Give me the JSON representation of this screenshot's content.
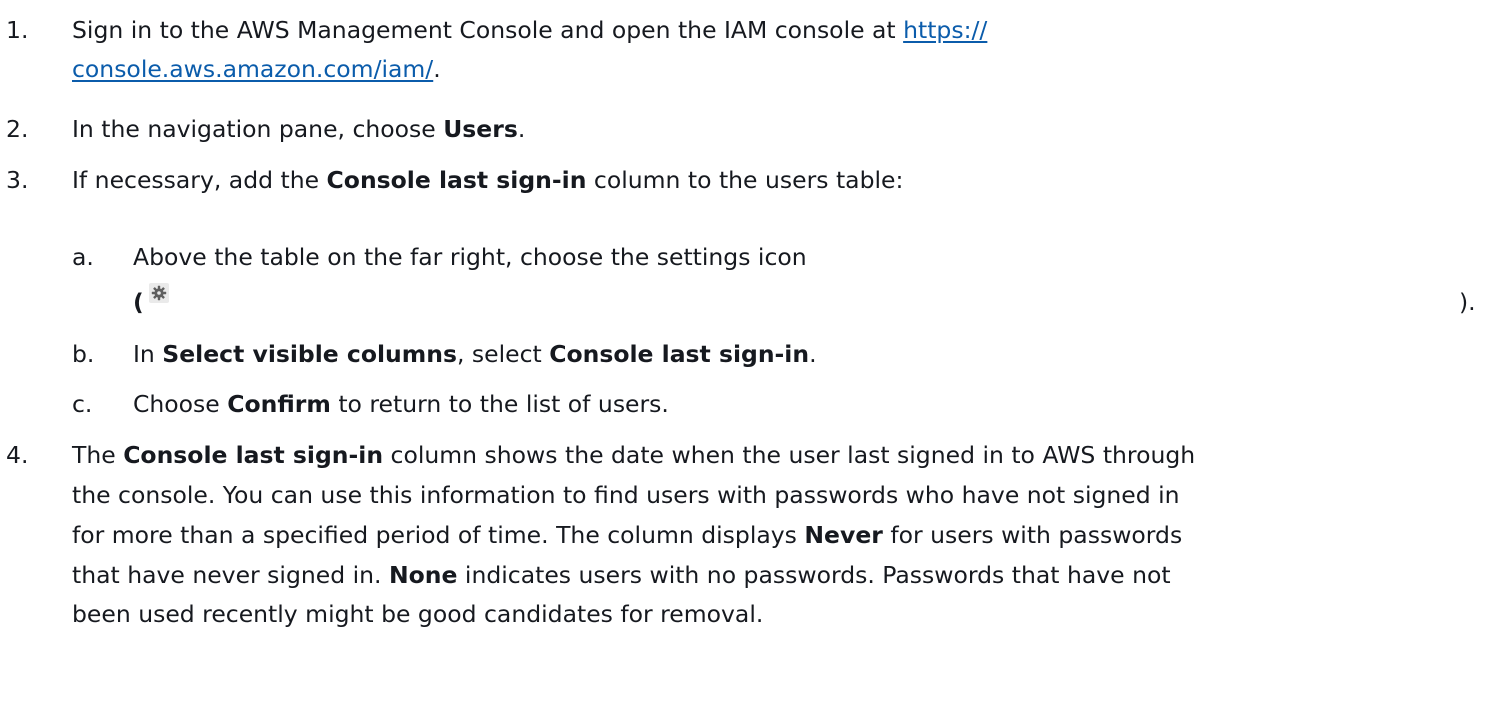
{
  "steps": [
    {
      "number": "1.",
      "line1_text": "Sign in to the AWS Management Console and open the IAM console at ",
      "link_part1": "https://",
      "link_part2": "console.aws.amazon.com/iam/",
      "line2_suffix": "."
    },
    {
      "number": "2.",
      "pre": "In the navigation pane, choose ",
      "bold": "Users",
      "post": "."
    },
    {
      "number": "3.",
      "pre": "If necessary, add the ",
      "bold": "Console last sign-in",
      "post": " column to the users table:",
      "substeps": [
        {
          "letter": "a.",
          "line1": "Above the table on the far right, choose the settings icon",
          "open_paren": "(",
          "close_paren": ").",
          "icon": "gear-icon"
        },
        {
          "letter": "b.",
          "pre": "In ",
          "bold1": "Select visible columns",
          "mid": ", select ",
          "bold2": "Console last sign-in",
          "post": "."
        },
        {
          "letter": "c.",
          "pre": "Choose ",
          "bold": "Confirm",
          "post": " to return to the list of users."
        }
      ]
    },
    {
      "number": "4.",
      "line1_pre": "The ",
      "line1_bold": "Console last sign-in",
      "line1_post": " column shows the date when the user last signed in to AWS through",
      "line2": "the console. You can use this information to find users with passwords who have not signed in",
      "line3_pre": "for more than a specified period of time. The column displays ",
      "line3_bold": "Never",
      "line3_post": " for users with passwords",
      "line4_pre": "that have never signed in. ",
      "line4_bold": "None",
      "line4_post": " indicates users with no passwords. Passwords that have not",
      "line5": "been used recently might be good candidates for removal."
    }
  ],
  "colors": {
    "text": "#16191f",
    "link": "#0b5cab"
  }
}
